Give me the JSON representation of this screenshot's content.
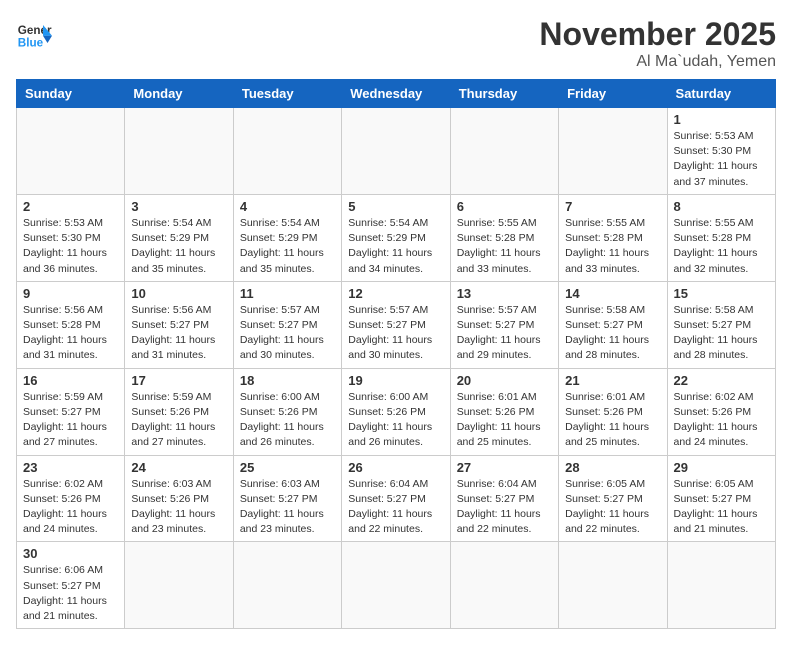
{
  "header": {
    "logo_general": "General",
    "logo_blue": "Blue",
    "month_title": "November 2025",
    "location": "Al Ma`udah, Yemen"
  },
  "days_of_week": [
    "Sunday",
    "Monday",
    "Tuesday",
    "Wednesday",
    "Thursday",
    "Friday",
    "Saturday"
  ],
  "weeks": [
    [
      {
        "day": "",
        "info": ""
      },
      {
        "day": "",
        "info": ""
      },
      {
        "day": "",
        "info": ""
      },
      {
        "day": "",
        "info": ""
      },
      {
        "day": "",
        "info": ""
      },
      {
        "day": "",
        "info": ""
      },
      {
        "day": "1",
        "info": "Sunrise: 5:53 AM\nSunset: 5:30 PM\nDaylight: 11 hours\nand 37 minutes."
      }
    ],
    [
      {
        "day": "2",
        "info": "Sunrise: 5:53 AM\nSunset: 5:30 PM\nDaylight: 11 hours\nand 36 minutes."
      },
      {
        "day": "3",
        "info": "Sunrise: 5:54 AM\nSunset: 5:29 PM\nDaylight: 11 hours\nand 35 minutes."
      },
      {
        "day": "4",
        "info": "Sunrise: 5:54 AM\nSunset: 5:29 PM\nDaylight: 11 hours\nand 35 minutes."
      },
      {
        "day": "5",
        "info": "Sunrise: 5:54 AM\nSunset: 5:29 PM\nDaylight: 11 hours\nand 34 minutes."
      },
      {
        "day": "6",
        "info": "Sunrise: 5:55 AM\nSunset: 5:28 PM\nDaylight: 11 hours\nand 33 minutes."
      },
      {
        "day": "7",
        "info": "Sunrise: 5:55 AM\nSunset: 5:28 PM\nDaylight: 11 hours\nand 33 minutes."
      },
      {
        "day": "8",
        "info": "Sunrise: 5:55 AM\nSunset: 5:28 PM\nDaylight: 11 hours\nand 32 minutes."
      }
    ],
    [
      {
        "day": "9",
        "info": "Sunrise: 5:56 AM\nSunset: 5:28 PM\nDaylight: 11 hours\nand 31 minutes."
      },
      {
        "day": "10",
        "info": "Sunrise: 5:56 AM\nSunset: 5:27 PM\nDaylight: 11 hours\nand 31 minutes."
      },
      {
        "day": "11",
        "info": "Sunrise: 5:57 AM\nSunset: 5:27 PM\nDaylight: 11 hours\nand 30 minutes."
      },
      {
        "day": "12",
        "info": "Sunrise: 5:57 AM\nSunset: 5:27 PM\nDaylight: 11 hours\nand 30 minutes."
      },
      {
        "day": "13",
        "info": "Sunrise: 5:57 AM\nSunset: 5:27 PM\nDaylight: 11 hours\nand 29 minutes."
      },
      {
        "day": "14",
        "info": "Sunrise: 5:58 AM\nSunset: 5:27 PM\nDaylight: 11 hours\nand 28 minutes."
      },
      {
        "day": "15",
        "info": "Sunrise: 5:58 AM\nSunset: 5:27 PM\nDaylight: 11 hours\nand 28 minutes."
      }
    ],
    [
      {
        "day": "16",
        "info": "Sunrise: 5:59 AM\nSunset: 5:27 PM\nDaylight: 11 hours\nand 27 minutes."
      },
      {
        "day": "17",
        "info": "Sunrise: 5:59 AM\nSunset: 5:26 PM\nDaylight: 11 hours\nand 27 minutes."
      },
      {
        "day": "18",
        "info": "Sunrise: 6:00 AM\nSunset: 5:26 PM\nDaylight: 11 hours\nand 26 minutes."
      },
      {
        "day": "19",
        "info": "Sunrise: 6:00 AM\nSunset: 5:26 PM\nDaylight: 11 hours\nand 26 minutes."
      },
      {
        "day": "20",
        "info": "Sunrise: 6:01 AM\nSunset: 5:26 PM\nDaylight: 11 hours\nand 25 minutes."
      },
      {
        "day": "21",
        "info": "Sunrise: 6:01 AM\nSunset: 5:26 PM\nDaylight: 11 hours\nand 25 minutes."
      },
      {
        "day": "22",
        "info": "Sunrise: 6:02 AM\nSunset: 5:26 PM\nDaylight: 11 hours\nand 24 minutes."
      }
    ],
    [
      {
        "day": "23",
        "info": "Sunrise: 6:02 AM\nSunset: 5:26 PM\nDaylight: 11 hours\nand 24 minutes."
      },
      {
        "day": "24",
        "info": "Sunrise: 6:03 AM\nSunset: 5:26 PM\nDaylight: 11 hours\nand 23 minutes."
      },
      {
        "day": "25",
        "info": "Sunrise: 6:03 AM\nSunset: 5:27 PM\nDaylight: 11 hours\nand 23 minutes."
      },
      {
        "day": "26",
        "info": "Sunrise: 6:04 AM\nSunset: 5:27 PM\nDaylight: 11 hours\nand 22 minutes."
      },
      {
        "day": "27",
        "info": "Sunrise: 6:04 AM\nSunset: 5:27 PM\nDaylight: 11 hours\nand 22 minutes."
      },
      {
        "day": "28",
        "info": "Sunrise: 6:05 AM\nSunset: 5:27 PM\nDaylight: 11 hours\nand 22 minutes."
      },
      {
        "day": "29",
        "info": "Sunrise: 6:05 AM\nSunset: 5:27 PM\nDaylight: 11 hours\nand 21 minutes."
      }
    ],
    [
      {
        "day": "30",
        "info": "Sunrise: 6:06 AM\nSunset: 5:27 PM\nDaylight: 11 hours\nand 21 minutes."
      },
      {
        "day": "",
        "info": ""
      },
      {
        "day": "",
        "info": ""
      },
      {
        "day": "",
        "info": ""
      },
      {
        "day": "",
        "info": ""
      },
      {
        "day": "",
        "info": ""
      },
      {
        "day": "",
        "info": ""
      }
    ]
  ]
}
